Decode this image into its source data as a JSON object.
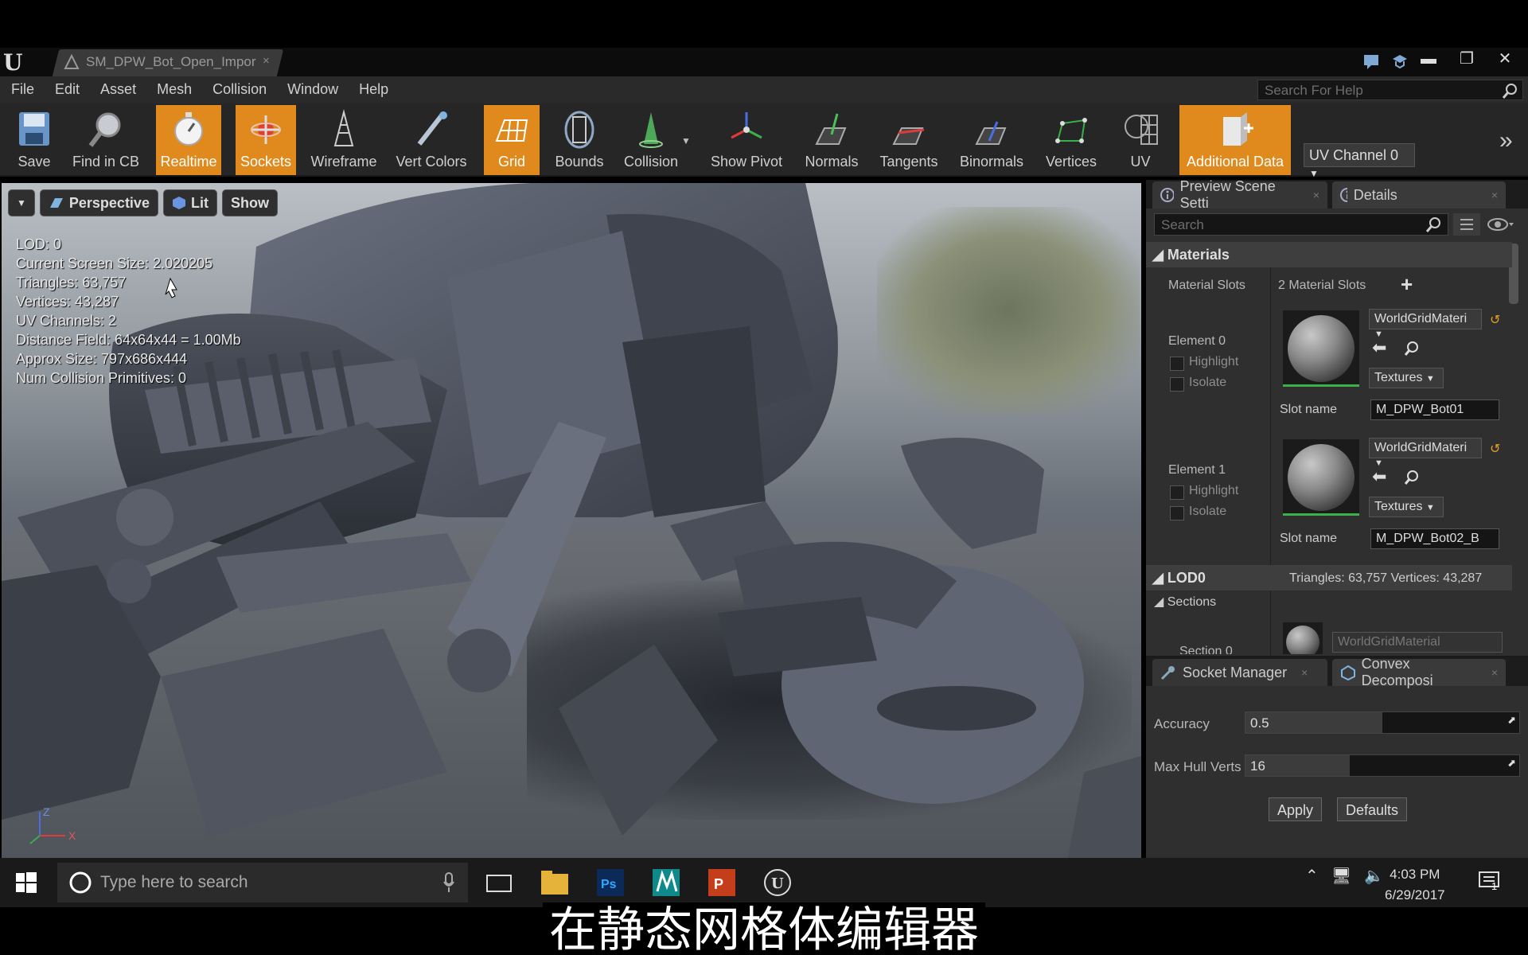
{
  "window": {
    "tab_title": "SM_DPW_Bot_Open_Impor",
    "tab_close": "×"
  },
  "menu": [
    "File",
    "Edit",
    "Asset",
    "Mesh",
    "Collision",
    "Window",
    "Help"
  ],
  "help_search": {
    "placeholder": "Search For Help"
  },
  "toolbar": {
    "items": [
      {
        "label": "Save",
        "icon": "save-icon",
        "active": false
      },
      {
        "label": "Find in CB",
        "icon": "find-icon",
        "active": false
      },
      {
        "label": "Realtime",
        "icon": "realtime-icon",
        "active": true
      },
      {
        "label": "Sockets",
        "icon": "sockets-icon",
        "active": true
      },
      {
        "label": "Wireframe",
        "icon": "wireframe-icon",
        "active": false
      },
      {
        "label": "Vert Colors",
        "icon": "vert-colors-icon",
        "active": false
      },
      {
        "label": "Grid",
        "icon": "grid-icon",
        "active": true
      },
      {
        "label": "Bounds",
        "icon": "bounds-icon",
        "active": false
      },
      {
        "label": "Collision",
        "icon": "collision-icon",
        "active": false
      },
      {
        "label": "Show Pivot",
        "icon": "pivot-icon",
        "active": false
      },
      {
        "label": "Normals",
        "icon": "normals-icon",
        "active": false
      },
      {
        "label": "Tangents",
        "icon": "tangents-icon",
        "active": false
      },
      {
        "label": "Binormals",
        "icon": "binormals-icon",
        "active": false
      },
      {
        "label": "Vertices",
        "icon": "vertices-icon",
        "active": false
      },
      {
        "label": "UV",
        "icon": "uv-icon",
        "active": false
      },
      {
        "label": "Additional Data",
        "icon": "additional-data-icon",
        "active": true
      }
    ],
    "uv_channel": "UV Channel 0",
    "accent": "#e08a1e"
  },
  "viewport": {
    "perspective": "Perspective",
    "lit": "Lit",
    "show": "Show",
    "stats": [
      "LOD:  0",
      "Current Screen Size:  2.020205",
      "Triangles:  63,757",
      "Vertices:  43,287",
      "UV Channels:  2",
      "Distance Field:  64x64x44 = 1.00Mb",
      "Approx Size: 797x686x444",
      "Num Collision Primitives:  0"
    ],
    "axis_z": "Z",
    "axis_x": "X"
  },
  "details": {
    "tab_preview": "Preview Scene Setti",
    "tab_details": "Details",
    "search_placeholder": "Search",
    "materials_header": "Materials",
    "material_slots_label": "Material Slots",
    "material_slots_value": "2 Material Slots",
    "elements": [
      {
        "name": "Element 0",
        "highlight": "Highlight",
        "isolate": "Isolate",
        "material": "WorldGridMateri",
        "textures": "Textures",
        "slot_label": "Slot name",
        "slot_value": "M_DPW_Bot01"
      },
      {
        "name": "Element 1",
        "highlight": "Highlight",
        "isolate": "Isolate",
        "material": "WorldGridMateri",
        "textures": "Textures",
        "slot_label": "Slot name",
        "slot_value": "M_DPW_Bot02_B"
      }
    ],
    "lod_header": "LOD0",
    "lod_info": "Triangles: 63,757    Vertices: 43,287",
    "sections": "Sections",
    "section_label": "Section 0",
    "section_material": "WorldGridMaterial"
  },
  "bottom": {
    "tab_socket": "Socket Manager",
    "tab_convex": "Convex Decomposi",
    "accuracy_label": "Accuracy",
    "accuracy_value": "0.5",
    "accuracy_fraction": 0.5,
    "hull_label": "Max Hull Verts",
    "hull_value": "16",
    "hull_fraction": 0.38,
    "apply": "Apply",
    "defaults": "Defaults"
  },
  "taskbar": {
    "search_placeholder": "Type here to search",
    "time": "4:03 PM",
    "date": "6/29/2017",
    "notifications": "1"
  },
  "subtitle": "在静态网格体编辑器"
}
